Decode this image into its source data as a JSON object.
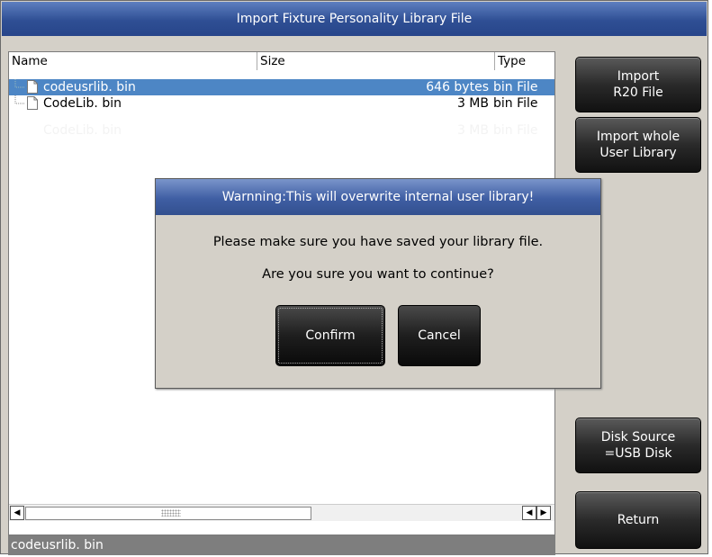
{
  "window": {
    "title": "Import Fixture Personality Library File"
  },
  "file_list": {
    "columns": {
      "name": "Name",
      "size": "Size",
      "type": "Type"
    },
    "rows": [
      {
        "name": "codeusrlib. bin",
        "size": "646 bytes",
        "type": "bin File",
        "selected": true
      },
      {
        "name": "CodeLib. bin",
        "size": "3 MB",
        "type": "bin File",
        "selected": false
      }
    ],
    "ghost_row": {
      "name": "CodeLib. bin",
      "size": "3 MB",
      "type": "bin File"
    }
  },
  "status_bar": {
    "text": "codeusrlib. bin"
  },
  "side_buttons": {
    "import_r20": "Import\nR20 File",
    "import_whole": "Import whole\nUser Library",
    "disk_source": "Disk Source\n=USB Disk",
    "return": "Return"
  },
  "dialog": {
    "title": "Warnning:This will overwrite internal user library!",
    "line1": "Please make sure you have saved your library file.",
    "line2": "Are you sure you want to continue?",
    "confirm": "Confirm",
    "cancel": "Cancel"
  },
  "scrollbar": {
    "left_arrow": "◀",
    "right_arrow": "▶"
  }
}
